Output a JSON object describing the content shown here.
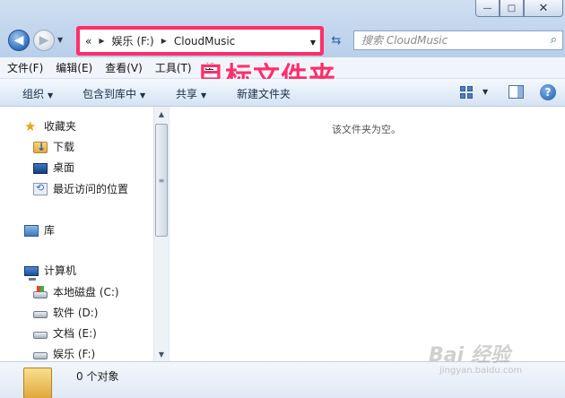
{
  "window": {
    "minimize_glyph": "—",
    "maximize_glyph": "□",
    "close_glyph": "✕"
  },
  "address": {
    "overflow": "«",
    "path": [
      "娱乐 (F:)",
      "CloudMusic"
    ]
  },
  "search": {
    "placeholder": "搜索 CloudMusic"
  },
  "menu": [
    "文件(F)",
    "编辑(E)",
    "查看(V)",
    "工具(T)",
    "帮"
  ],
  "annotation": "目标文件夹",
  "toolbar": {
    "organize": "组织",
    "include_in_library": "包含到库中",
    "share": "共享",
    "new_folder": "新建文件夹"
  },
  "nav": {
    "favorites": {
      "label": "收藏夹",
      "items": [
        "下载",
        "桌面",
        "最近访问的位置"
      ]
    },
    "libraries": "库",
    "computer": {
      "label": "计算机",
      "items": [
        "本地磁盘 (C:)",
        "软件 (D:)",
        "文档 (E:)",
        "娱乐 (F:)"
      ]
    }
  },
  "content": {
    "empty_message": "该文件夹为空。"
  },
  "details": {
    "object_count": "0 个对象"
  },
  "watermark": {
    "main": "Bai 经验",
    "sub": "jingyan.baidu.com"
  },
  "colors": {
    "highlight": "#ff2e6b",
    "nav_accent": "#2f6fbf"
  }
}
